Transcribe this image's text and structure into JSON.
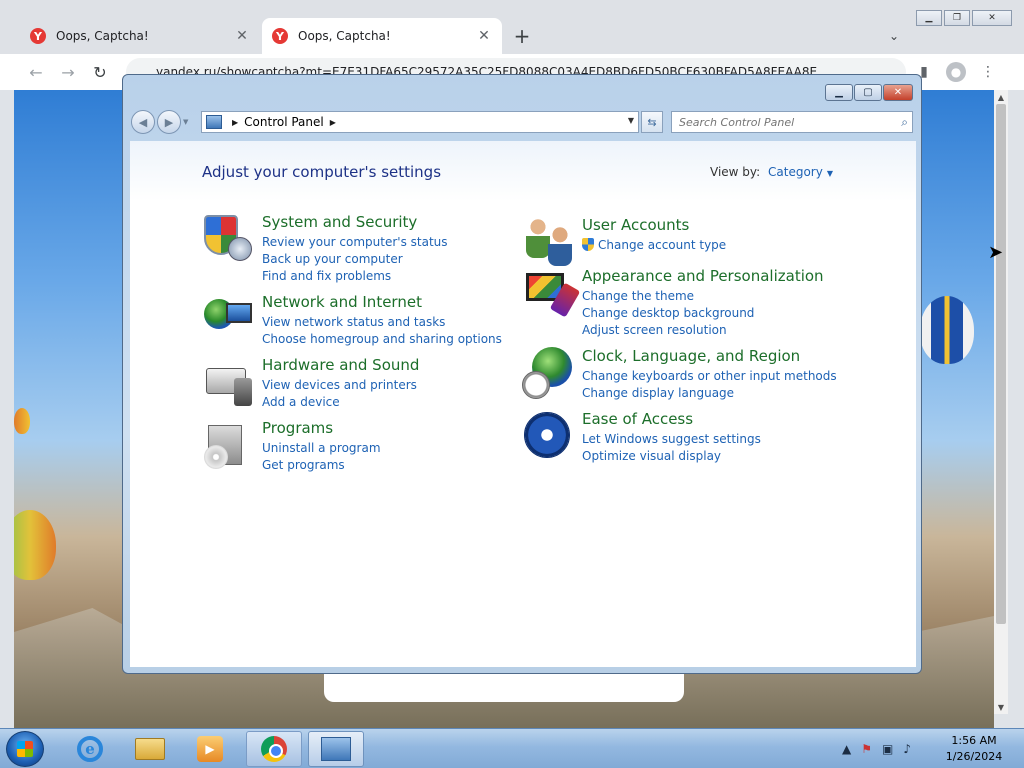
{
  "browser": {
    "tabs": [
      {
        "title": "Oops, Captcha!",
        "favicon": "Y",
        "active": false
      },
      {
        "title": "Oops, Captcha!",
        "favicon": "Y",
        "active": true
      }
    ],
    "new_tab_icon": "+",
    "url": "yandex.ru/showcaptcha?mt=E7E31DFA65C29572A35C25FD8088C03A4ED8BD6FD50BCF630BFAD5A8FEAA8E"
  },
  "control_panel": {
    "breadcrumb": "Control Panel",
    "search_placeholder": "Search Control Panel",
    "heading": "Adjust your computer's settings",
    "view_by_label": "View by:",
    "view_by_value": "Category",
    "left_categories": [
      {
        "title": "System and Security",
        "icon": "shield-icon",
        "links": [
          "Review your computer's status",
          "Back up your computer",
          "Find and fix problems"
        ]
      },
      {
        "title": "Network and Internet",
        "icon": "network-icon",
        "links": [
          "View network status and tasks",
          "Choose homegroup and sharing options"
        ]
      },
      {
        "title": "Hardware and Sound",
        "icon": "printer-icon",
        "links": [
          "View devices and printers",
          "Add a device"
        ]
      },
      {
        "title": "Programs",
        "icon": "programs-icon",
        "links": [
          "Uninstall a program",
          "Get programs"
        ]
      }
    ],
    "right_categories": [
      {
        "title": "User Accounts",
        "icon": "users-icon",
        "links": [
          "Change account type"
        ]
      },
      {
        "title": "Appearance and Personalization",
        "icon": "appearance-icon",
        "links": [
          "Change the theme",
          "Change desktop background",
          "Adjust screen resolution"
        ]
      },
      {
        "title": "Clock, Language, and Region",
        "icon": "clock-globe-icon",
        "links": [
          "Change keyboards or other input methods",
          "Change display language"
        ]
      },
      {
        "title": "Ease of Access",
        "icon": "ease-of-access-icon",
        "links": [
          "Let Windows suggest settings",
          "Optimize visual display"
        ]
      }
    ]
  },
  "taskbar": {
    "time": "1:56 AM",
    "date": "1/26/2024"
  },
  "colors": {
    "category_title": "#1c6e2a",
    "link": "#1e62b4",
    "heading": "#1e3287"
  }
}
